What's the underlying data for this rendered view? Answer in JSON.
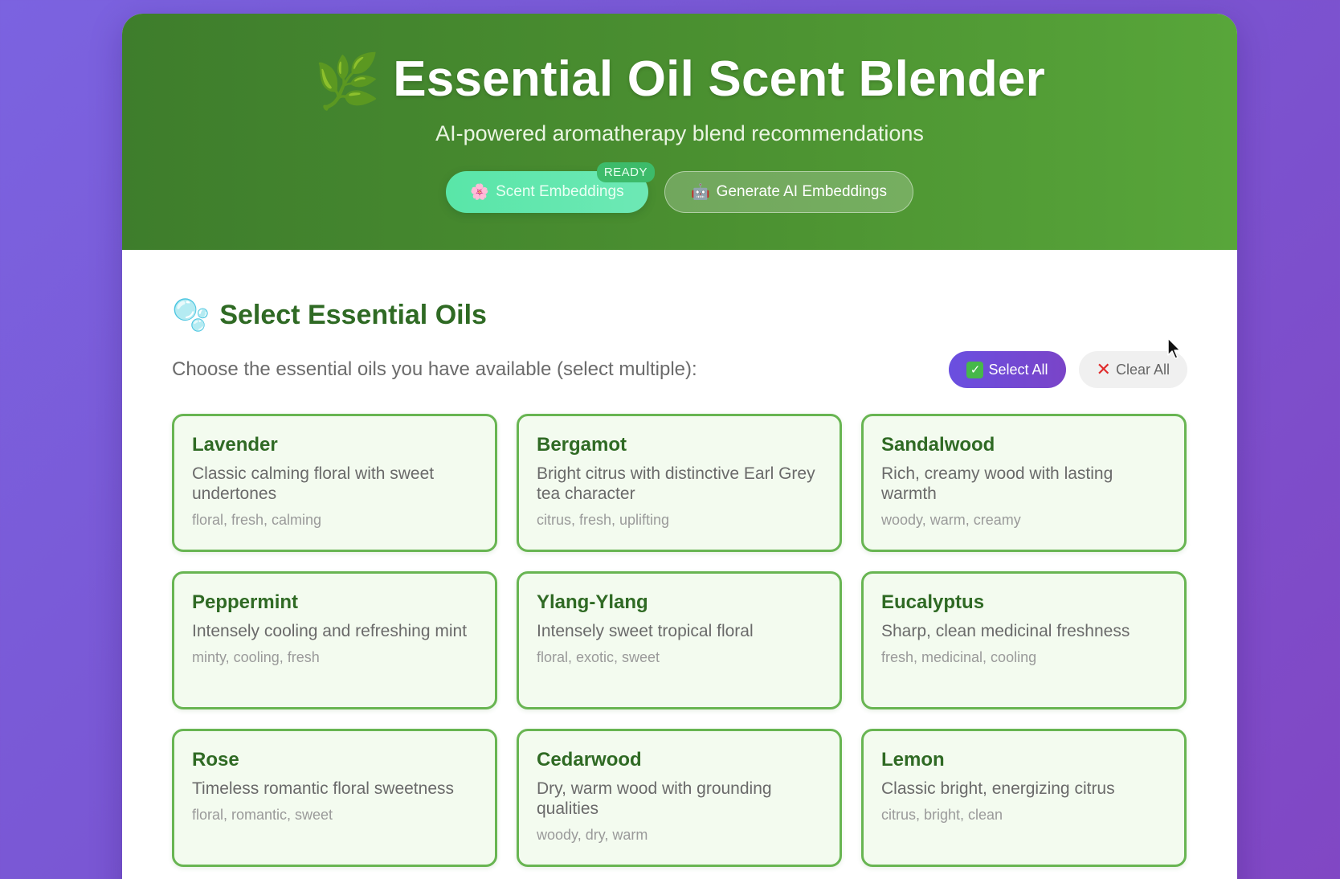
{
  "header": {
    "icon": "herb-leaf-icon",
    "title": "Essential Oil Scent Blender",
    "subtitle": "AI-powered aromatherapy blend recommendations",
    "embeddings_pill": {
      "icon": "🌸",
      "label": "Scent Embeddings",
      "badge": "READY"
    },
    "generate_pill": {
      "icon": "🤖",
      "label": "Generate AI Embeddings"
    },
    "colors": {
      "header_start": "#3e7d2c",
      "header_end": "#58a63a",
      "accent_pill": "#59e6a8"
    }
  },
  "section": {
    "icon": "bubbles-icon",
    "title": "Select Essential Oils",
    "instructions": "Choose the essential oils you have available (select multiple):",
    "select_all": {
      "icon": "✅",
      "label": "Select All"
    },
    "clear_all": {
      "icon": "❌",
      "label": "Clear All"
    }
  },
  "oils": [
    {
      "name": "Lavender",
      "description": "Classic calming floral with sweet undertones",
      "tags": "floral, fresh, calming"
    },
    {
      "name": "Bergamot",
      "description": "Bright citrus with distinctive Earl Grey tea character",
      "tags": "citrus, fresh, uplifting"
    },
    {
      "name": "Sandalwood",
      "description": "Rich, creamy wood with lasting warmth",
      "tags": "woody, warm, creamy"
    },
    {
      "name": "Peppermint",
      "description": "Intensely cooling and refreshing mint",
      "tags": "minty, cooling, fresh"
    },
    {
      "name": "Ylang-Ylang",
      "description": "Intensely sweet tropical floral",
      "tags": "floral, exotic, sweet"
    },
    {
      "name": "Eucalyptus",
      "description": "Sharp, clean medicinal freshness",
      "tags": "fresh, medicinal, cooling"
    },
    {
      "name": "Rose",
      "description": "Timeless romantic floral sweetness",
      "tags": "floral, romantic, sweet"
    },
    {
      "name": "Cedarwood",
      "description": "Dry, warm wood with grounding qualities",
      "tags": "woody, dry, warm"
    },
    {
      "name": "Lemon",
      "description": "Classic bright, energizing citrus",
      "tags": "citrus, bright, clean"
    }
  ]
}
